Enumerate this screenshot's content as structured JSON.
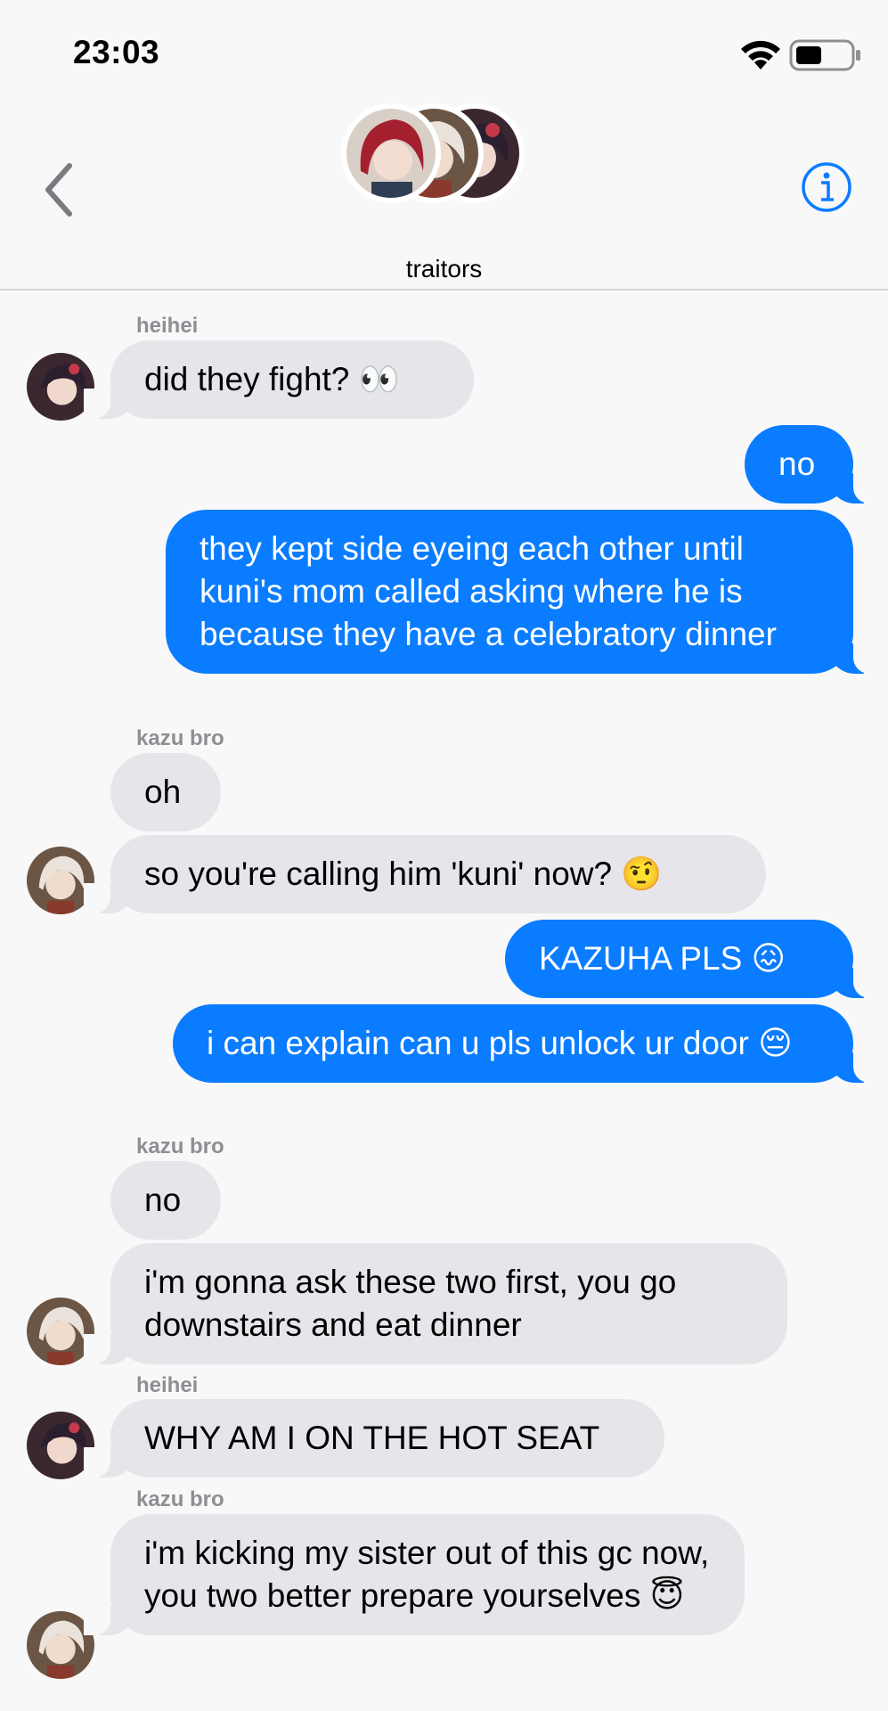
{
  "status_bar": {
    "time": "23:03",
    "wifi_icon": "wifi-icon",
    "battery_icon": "battery-icon"
  },
  "header": {
    "back_icon": "chevron-left-icon",
    "info_icon": "info-icon",
    "group_name": "traitors",
    "accent_color": "#0a7cff"
  },
  "messages": [
    {
      "sender": "heihei",
      "text": "did they fight? 👀",
      "direction": "incoming"
    },
    {
      "text": "no",
      "direction": "outgoing"
    },
    {
      "text": "they kept side eyeing each other until kuni's mom called asking where he is because they have a celebratory dinner",
      "direction": "outgoing"
    },
    {
      "sender": "kazu bro",
      "text": "oh",
      "direction": "incoming"
    },
    {
      "text": "so you're calling him 'kuni' now? 🤨",
      "direction": "incoming"
    },
    {
      "text": "KAZUHA PLS 😖",
      "direction": "outgoing"
    },
    {
      "text": "i can explain can u pls unlock ur door 😔",
      "direction": "outgoing"
    },
    {
      "sender": "kazu bro",
      "text": "no",
      "direction": "incoming"
    },
    {
      "text": "i'm gonna ask these two first, you go downstairs and eat dinner",
      "direction": "incoming"
    },
    {
      "sender": "heihei",
      "text": "WHY AM I ON THE HOT SEAT",
      "direction": "incoming"
    },
    {
      "sender": "kazu bro",
      "text": "i'm kicking my sister out of this gc now, you two better prepare yourselves 😇",
      "direction": "incoming"
    }
  ]
}
